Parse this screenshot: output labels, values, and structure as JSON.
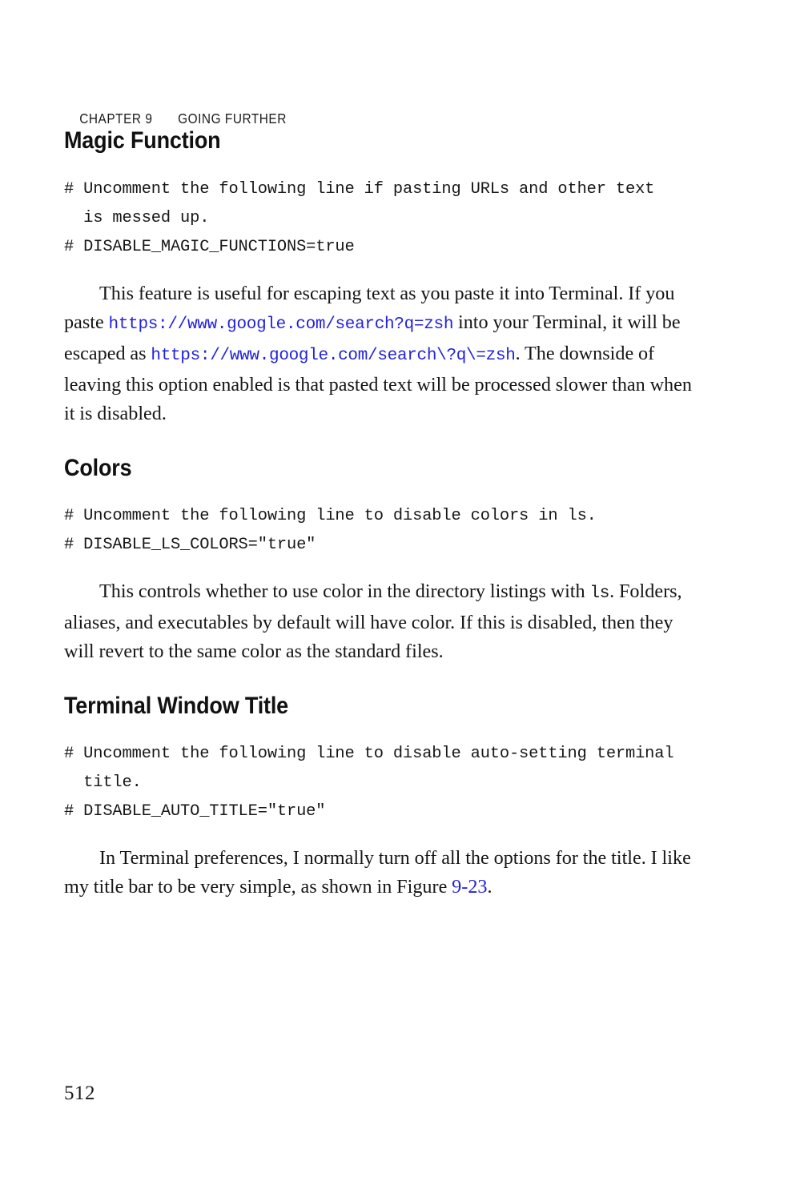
{
  "running_head": {
    "chapter": "CHAPTER 9",
    "title": "GOING FURTHER"
  },
  "folio": "512",
  "colors": {
    "link": "#2222dd",
    "text": "#161616",
    "heading": "#111111",
    "page_background": "#ffffff"
  },
  "sections": [
    {
      "heading": "Magic Function",
      "code": "# Uncomment the following line if pasting URLs and other text\n  is messed up.\n# DISABLE_MAGIC_FUNCTIONS=true",
      "paragraph": {
        "part1": "This feature is useful for escaping text as you paste it into Terminal. If you paste ",
        "url1": "https://www.google.com/search?q=zsh",
        "part2": " into your Terminal, it will be escaped as ",
        "url2": "https://www.google.com/search\\?q\\=zsh",
        "part3": ". The downside of leaving this option enabled is that pasted text will be processed slower than when it is disabled."
      }
    },
    {
      "heading": "Colors",
      "code": "# Uncomment the following line to disable colors in ls.\n# DISABLE_LS_COLORS=\"true\"",
      "paragraph": {
        "part1": "This controls whether to use color in the directory listings with ",
        "code1": "ls",
        "part2": ". Folders, aliases, and executables by default will have color. If this is disabled, then they will revert to the same color as the standard files."
      }
    },
    {
      "heading": "Terminal Window Title",
      "code": "# Uncomment the following line to disable auto-setting terminal\n  title.\n# DISABLE_AUTO_TITLE=\"true\"",
      "paragraph": {
        "part1": "In Terminal preferences, I normally turn off all the options for the title. I like my title bar to be very simple, as shown in Figure ",
        "xref": "9-23",
        "part2": "."
      }
    }
  ]
}
